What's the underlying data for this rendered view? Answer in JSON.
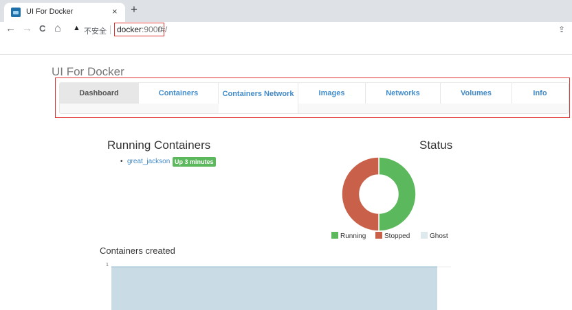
{
  "browser": {
    "tab_title": "UI For Docker",
    "tab_close": "×",
    "new_tab": "+",
    "back": "←",
    "forward": "→",
    "reload": "C",
    "home": "⌂",
    "security_icon": "▲",
    "security_label": "不安全",
    "url_host": "docker",
    "url_port": ":9000",
    "url_path": "/#/",
    "share_icon": "⇪"
  },
  "app": {
    "title": "UI For Docker",
    "nav": [
      {
        "label": "Dashboard",
        "active": true
      },
      {
        "label": "Containers"
      },
      {
        "label": "Containers Network"
      },
      {
        "label": "Images"
      },
      {
        "label": "Networks"
      },
      {
        "label": "Volumes"
      },
      {
        "label": "Info"
      }
    ]
  },
  "running": {
    "title": "Running Containers",
    "items": [
      {
        "bullet": "•",
        "name": "great_jackson",
        "status": "Up 3 minutes"
      }
    ]
  },
  "status": {
    "title": "Status",
    "legend": [
      {
        "label": "Running",
        "color": "#5cb85c"
      },
      {
        "label": "Stopped",
        "color": "#c9604a"
      },
      {
        "label": "Ghost",
        "color": "#dde9ec"
      }
    ]
  },
  "chart_data": [
    {
      "type": "pie",
      "title": "Status",
      "categories": [
        "Running",
        "Stopped",
        "Ghost"
      ],
      "values": [
        1,
        1,
        0
      ],
      "colors": [
        "#5cb85c",
        "#c9604a",
        "#dde9ec"
      ],
      "legend": "bottom"
    },
    {
      "type": "area",
      "title": "Containers created",
      "ytick_labels": [
        "1"
      ],
      "values": [
        1,
        1
      ],
      "ylim": [
        0,
        1
      ],
      "color": "#c9dce6"
    }
  ]
}
